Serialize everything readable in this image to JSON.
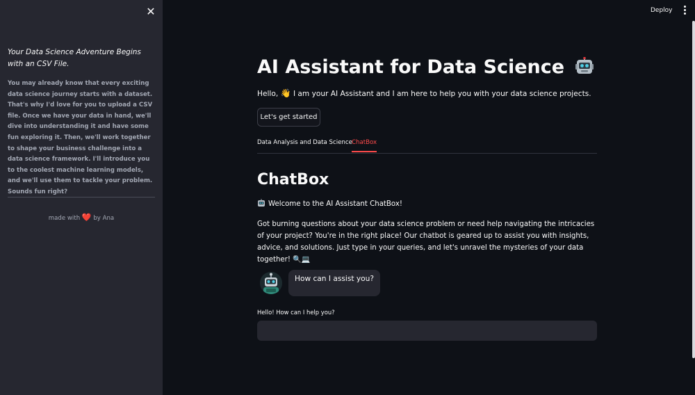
{
  "sidebar": {
    "heading": "Your Data Science Adventure Begins with an CSV File.",
    "body": "You may already know that every exciting data science journey starts with a dataset. That's why I'd love for you to upload a CSV file. Once we have your data in hand, we'll dive into understanding it and have some fun exploring it. Then, we'll work together to shape your business challenge into a data science framework. I'll introduce you to the coolest machine learning models, and we'll use them to tackle your problem. Sounds fun right?",
    "footer_prefix": "made with",
    "footer_heart": "❤️",
    "footer_suffix": "by Ana",
    "close_glyph": "✕"
  },
  "header": {
    "deploy_label": "Deploy"
  },
  "main": {
    "title": "AI Assistant for Data Science",
    "intro_prefix": "Hello,",
    "intro_wave": "👋",
    "intro_suffix": "I am your AI Assistant and I am here to help you with your data science projects.",
    "start_button": "Let's get started",
    "tabs": [
      {
        "label": "Data Analysis and Data Science",
        "active": false
      },
      {
        "label": "ChatBox",
        "active": true
      }
    ],
    "section_title": "ChatBox",
    "welcome": "Welcome to the AI Assistant ChatBox!",
    "paragraph": "Got burning questions about your data science problem or need help navigating the intricacies of your project? You're in the right place! Our chatbot is geared up to assist you with insights, advice, and solutions. Just type in your queries, and let's unravel the mysteries of your data together! 🔍💻",
    "chat_message": "How can I assist you?",
    "input_label": "Hello! How can I help you?",
    "input_placeholder": ""
  },
  "colors": {
    "background": "#0e1117",
    "sidebar": "#262730",
    "accent": "#ff4b4b",
    "text": "#fafafa",
    "muted_text": "#a3a8b4"
  }
}
